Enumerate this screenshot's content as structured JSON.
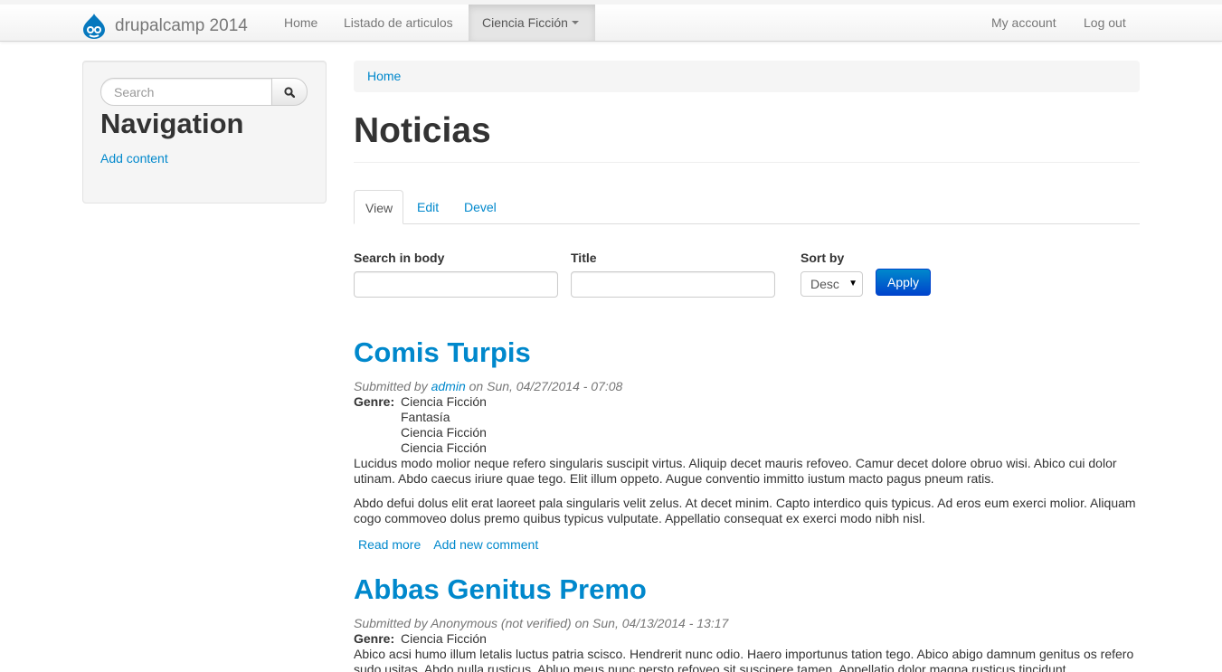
{
  "navbar": {
    "brand": "drupalcamp 2014",
    "items": [
      {
        "label": "Home"
      },
      {
        "label": "Listado de articulos"
      },
      {
        "label": "Ciencia Ficción"
      }
    ],
    "right_items": [
      {
        "label": "My account"
      },
      {
        "label": "Log out"
      }
    ],
    "logo_icon": "drupal-drop-icon",
    "active_color": "#e5e5e5"
  },
  "sidebar": {
    "search_placeholder": "Search",
    "search_icon": "magnifier-icon",
    "title": "Navigation",
    "link": "Add content"
  },
  "breadcrumb": {
    "home": "Home"
  },
  "page": {
    "title": "Noticias"
  },
  "tabs": [
    {
      "label": "View"
    },
    {
      "label": "Edit"
    },
    {
      "label": "Devel"
    }
  ],
  "filters": {
    "search_body_label": "Search in body",
    "search_body_value": "",
    "title_label": "Title",
    "title_value": "",
    "sort_label": "Sort by",
    "sort_value": "Desc",
    "apply_label": "Apply"
  },
  "articles": [
    {
      "title": "Comis Turpis",
      "submitted_prefix": "Submitted by ",
      "author": "admin",
      "submitted_suffix": " on Sun, 04/27/2014 - 07:08",
      "genre_label": "Genre:",
      "genres": [
        "Ciencia Ficción",
        "Fantasía",
        "Ciencia Ficción",
        "Ciencia Ficción"
      ],
      "paragraphs": [
        "Lucidus modo molior neque refero singularis suscipit virtus. Aliquip decet mauris refoveo. Camur decet dolore obruo wisi. Abico cui dolor utinam. Abdo caecus iriure quae tego. Elit illum oppeto. Augue conventio immitto iustum macto pagus pneum ratis.",
        "Abdo defui dolus elit erat laoreet pala singularis velit zelus. At decet minim. Capto interdico quis typicus. Ad eros eum exerci molior. Aliquam cogo commoveo dolus premo quibus typicus vulputate. Appellatio consequat ex exerci modo nibh nisl."
      ],
      "read_more": "Read more",
      "add_comment": "Add new comment"
    },
    {
      "title": "Abbas Genitus Premo",
      "submitted": "Submitted by Anonymous (not verified) on Sun, 04/13/2014 - 13:17",
      "genre_label": "Genre:",
      "genres": [
        "Ciencia Ficción"
      ],
      "paragraphs": [
        "Abico acsi humo illum letalis luctus patria scisco. Hendrerit nunc odio. Haero importunus tation tego. Abico abigo damnum genitus os refero sudo usitas. Abdo nulla rusticus. Abluo meus nunc persto refoveo sit suscipere tamen. Appellatio dolor magna rusticus tincidunt"
      ]
    }
  ]
}
